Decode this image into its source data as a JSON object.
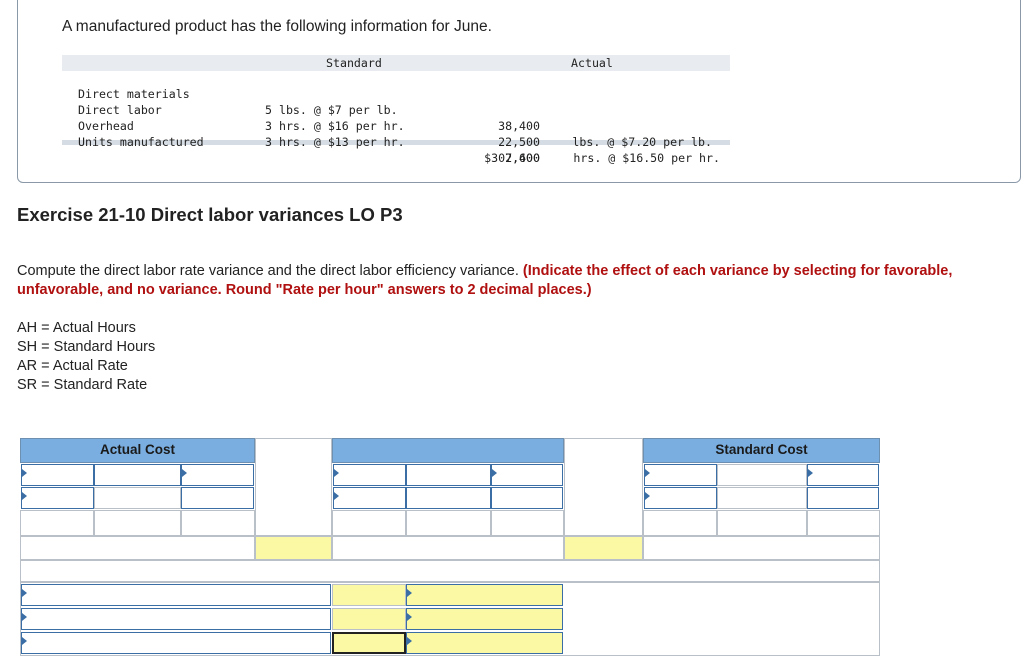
{
  "intro": "A manufactured product has the following information for June.",
  "data_table": {
    "header_standard": "Standard",
    "header_actual": "Actual",
    "rows": [
      {
        "label": "Direct materials",
        "standard": "5 lbs. @ $7 per lb.",
        "actual_qty": "38,400",
        "actual_rate": "lbs. @ $7.20 per lb."
      },
      {
        "label": "Direct labor",
        "standard": "3 hrs. @ $16 per hr.",
        "actual_qty": "22,500",
        "actual_rate": "hrs. @ $16.50 per hr."
      },
      {
        "label": "Overhead",
        "standard": "3 hrs. @ $13 per hr.",
        "actual_qty": "$302,400",
        "actual_rate": ""
      },
      {
        "label": "Units manufactured",
        "standard": "",
        "actual_qty": "7,600",
        "actual_rate": ""
      }
    ]
  },
  "exercise_title": "Exercise 21-10 Direct labor variances LO P3",
  "instructions_plain": "Compute the direct labor rate variance and the direct labor efficiency variance. ",
  "instructions_red": "(Indicate the effect of each variance by selecting for favorable, unfavorable, and no variance. Round \"Rate per hour\" answers to 2 decimal places.)",
  "definitions": [
    "AH = Actual Hours",
    "SH = Standard Hours",
    "AR = Actual Rate",
    "SR = Standard Rate"
  ],
  "worksheet": {
    "actual_cost_header": "Actual Cost",
    "standard_cost_header": "Standard Cost"
  }
}
